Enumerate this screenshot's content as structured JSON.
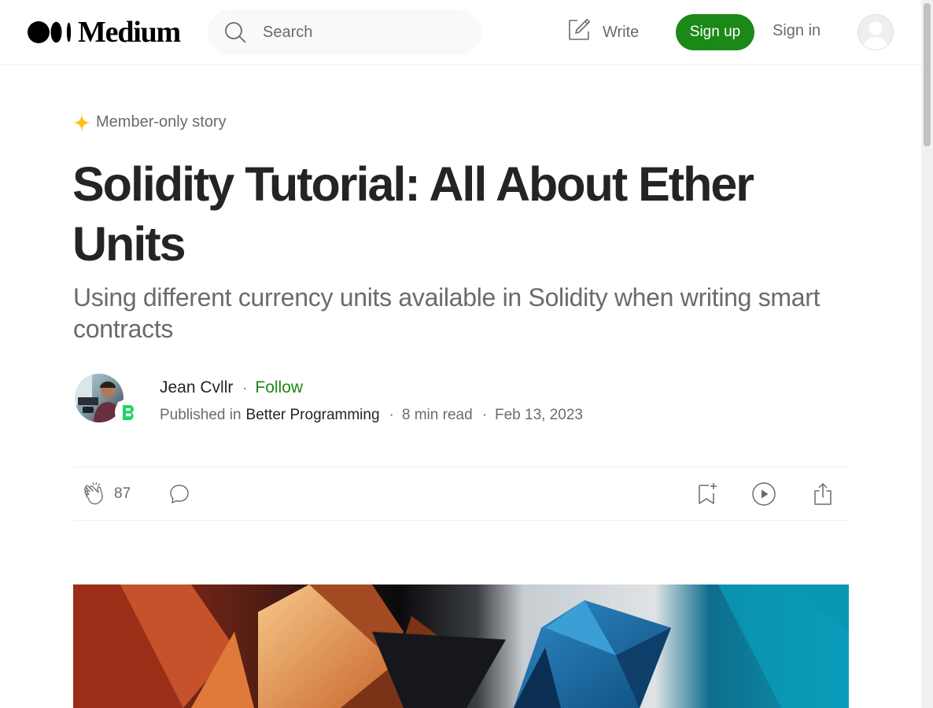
{
  "header": {
    "logo_text": "Medium",
    "search": {
      "placeholder": "Search"
    },
    "write_label": "Write",
    "signup_label": "Sign up",
    "signin_label": "Sign in"
  },
  "article": {
    "member_label": "Member-only story",
    "title": "Solidity Tutorial: All About Ether Units",
    "subtitle": "Using different currency units available in Solidity when writing smart contracts",
    "author": {
      "name": "Jean Cvllr",
      "dot": "·",
      "follow_label": "Follow"
    },
    "meta": {
      "published_in": "Published in",
      "publication": "Better Programming",
      "read_time": "8 min read",
      "date": "Feb 13, 2023",
      "separator": "·"
    },
    "actions": {
      "clap_count": "87"
    }
  },
  "colors": {
    "accent_green": "#1a8917",
    "text_primary": "#242424",
    "text_secondary": "#6b6b6b",
    "member_star": "#ffc017"
  },
  "icons": [
    "search-icon",
    "write-icon",
    "user-avatar-icon",
    "star-icon",
    "clap-icon",
    "comment-icon",
    "bookmark-icon",
    "play-icon",
    "share-icon"
  ]
}
